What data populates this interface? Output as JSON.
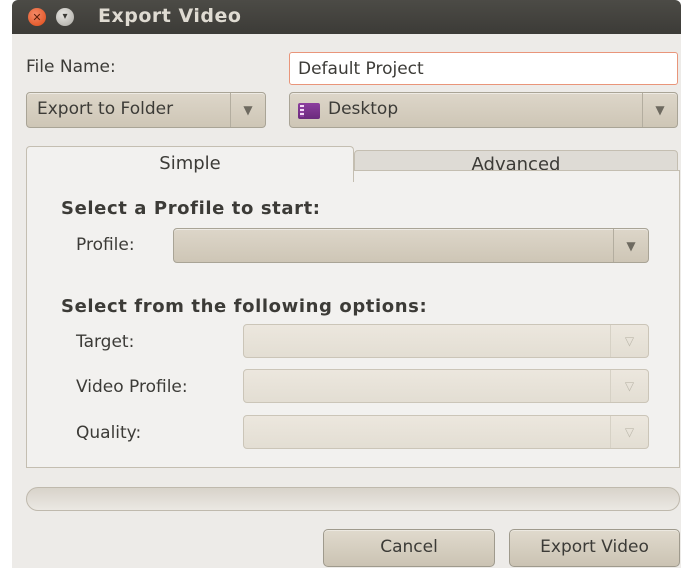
{
  "window": {
    "title": "Export Video"
  },
  "file_name": {
    "label": "File Name:",
    "value": "Default Project"
  },
  "export_mode": {
    "selected": "Export to Folder"
  },
  "folder": {
    "selected": "Desktop",
    "icon": "folder-icon"
  },
  "tabs": [
    {
      "label": "Simple",
      "active": true
    },
    {
      "label": "Advanced",
      "active": false
    }
  ],
  "simple": {
    "profile_heading": "Select a Profile to start:",
    "profile_label": "Profile:",
    "options_heading": "Select from the following options:",
    "target_label": "Target:",
    "video_profile_label": "Video Profile:",
    "quality_label": "Quality:"
  },
  "progress": {
    "fraction": 0
  },
  "buttons": {
    "cancel": "Cancel",
    "export": "Export Video"
  },
  "colors": {
    "titlebar": "#3c3b37",
    "accent": "#f07746",
    "background": "#edebe8"
  }
}
